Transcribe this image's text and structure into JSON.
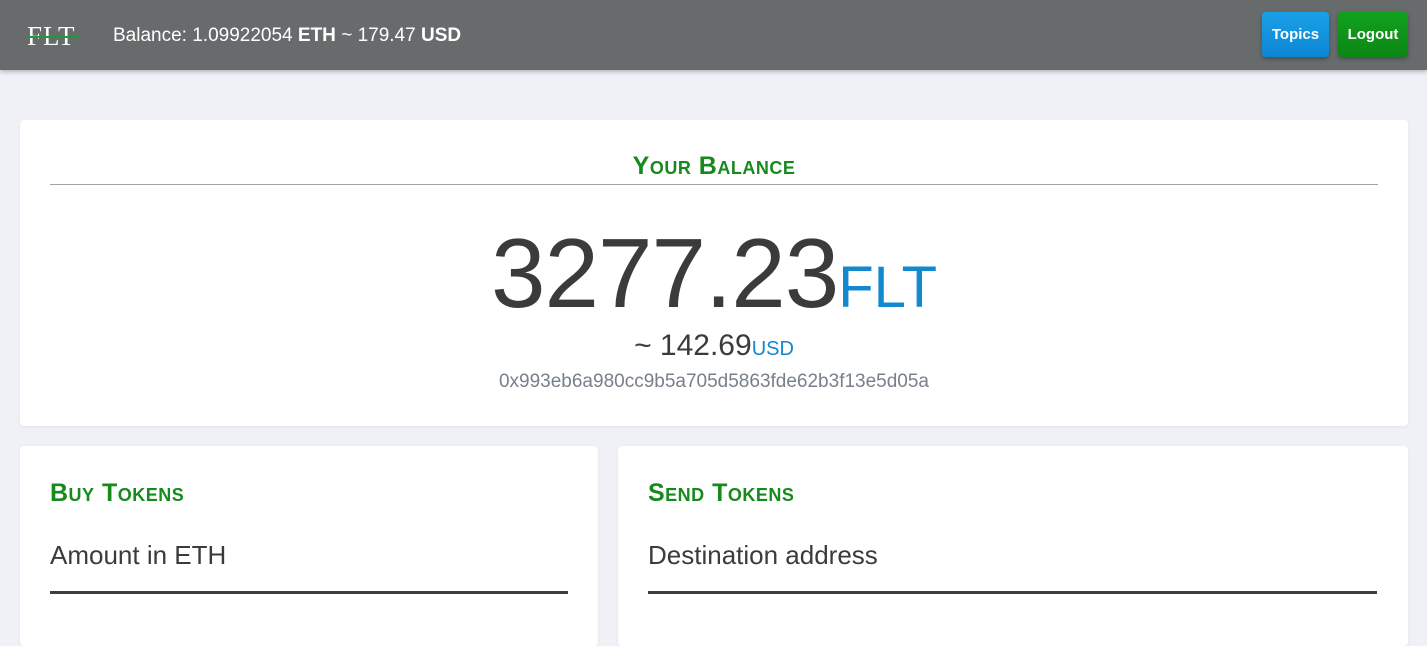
{
  "header": {
    "logo_text": "FLT",
    "balance_label": "Balance: ",
    "eth_amount": "1.09922054",
    "eth_unit": "ETH",
    "approx": "~",
    "usd_amount": "179.47",
    "usd_unit": "USD",
    "topics_label": "Topics",
    "logout_label": "Logout"
  },
  "balance_card": {
    "title": "Your Balance",
    "amount": "3277.23",
    "currency": "FLT",
    "usd_prefix": "~ ",
    "usd_amount": "142.69",
    "usd_unit": "USD",
    "address": "0x993eb6a980cc9b5a705d5863fde62b3f13e5d05a"
  },
  "buy_card": {
    "title": "Buy Tokens",
    "field_label": "Amount in ETH"
  },
  "send_card": {
    "title": "Send Tokens",
    "field_label": "Destination address"
  },
  "colors": {
    "topbar": "#676b6c",
    "accent_green": "#178a1d",
    "accent_blue": "#1488cf",
    "topics_button": "#1aa0e8",
    "logout_button": "#11a21d",
    "page_background": "#f0f1f7"
  }
}
